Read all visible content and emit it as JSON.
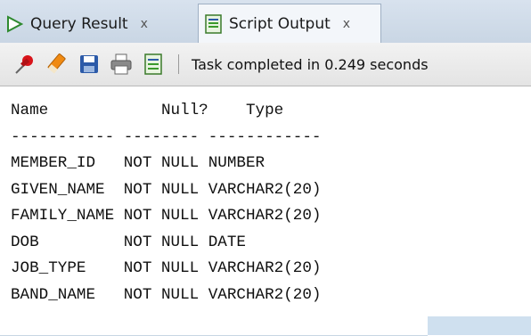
{
  "tabs": [
    {
      "label": "Query Result",
      "close": "x",
      "active": false
    },
    {
      "label": "Script Output",
      "close": "x",
      "active": true
    }
  ],
  "toolbar": {
    "icons": [
      "pin-icon",
      "eraser-icon",
      "save-icon",
      "print-icon",
      "script-icon"
    ],
    "status": "Task completed in 0.249 seconds"
  },
  "output": {
    "header": {
      "name": "Name",
      "null": "Null?",
      "type": "Type"
    },
    "divider": {
      "name": "-----------",
      "null": "--------",
      "type": "------------"
    },
    "rows": [
      {
        "name": "MEMBER_ID",
        "null": "NOT NULL",
        "type": "NUMBER"
      },
      {
        "name": "GIVEN_NAME",
        "null": "NOT NULL",
        "type": "VARCHAR2(20)"
      },
      {
        "name": "FAMILY_NAME",
        "null": "NOT NULL",
        "type": "VARCHAR2(20)"
      },
      {
        "name": "DOB",
        "null": "NOT NULL",
        "type": "DATE"
      },
      {
        "name": "JOB_TYPE",
        "null": "NOT NULL",
        "type": "VARCHAR2(20)"
      },
      {
        "name": "BAND_NAME",
        "null": "NOT NULL",
        "type": "VARCHAR2(20)"
      }
    ]
  },
  "colors": {
    "tab_strip": "#c9d6e4",
    "pin_red": "#d8141a",
    "eraser_orange": "#f08a12",
    "save_blue": "#2c5aa8",
    "script_green": "#3a9a2a"
  }
}
